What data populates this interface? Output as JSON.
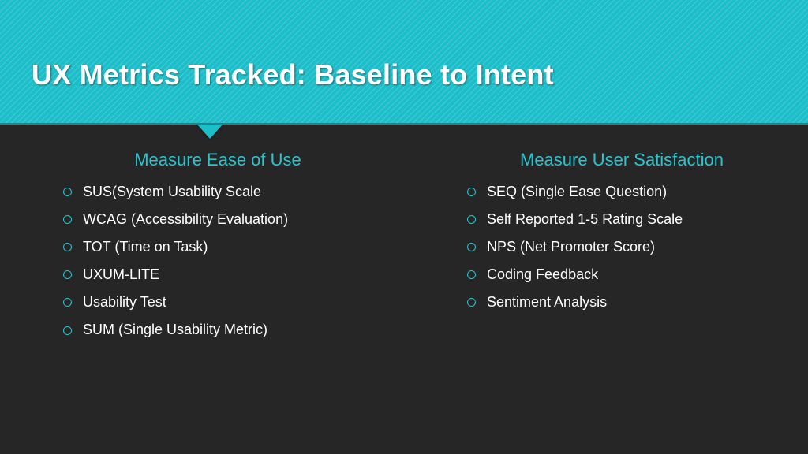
{
  "title": "UX Metrics Tracked: Baseline to Intent",
  "columns": {
    "left": {
      "heading": "Measure Ease of Use",
      "items": [
        "SUS(System Usability Scale",
        "WCAG (Accessibility Evaluation)",
        "TOT (Time on Task)",
        "UXUM-LITE",
        "Usability Test",
        "SUM (Single Usability Metric)"
      ]
    },
    "right": {
      "heading": "Measure User Satisfaction",
      "items": [
        "SEQ (Single Ease Question)",
        "Self Reported 1-5 Rating Scale",
        "NPS (Net Promoter Score)",
        "Coding Feedback",
        "Sentiment Analysis"
      ]
    }
  },
  "colors": {
    "accent": "#1cbec9",
    "bg": "#262626",
    "text": "#ffffff"
  }
}
